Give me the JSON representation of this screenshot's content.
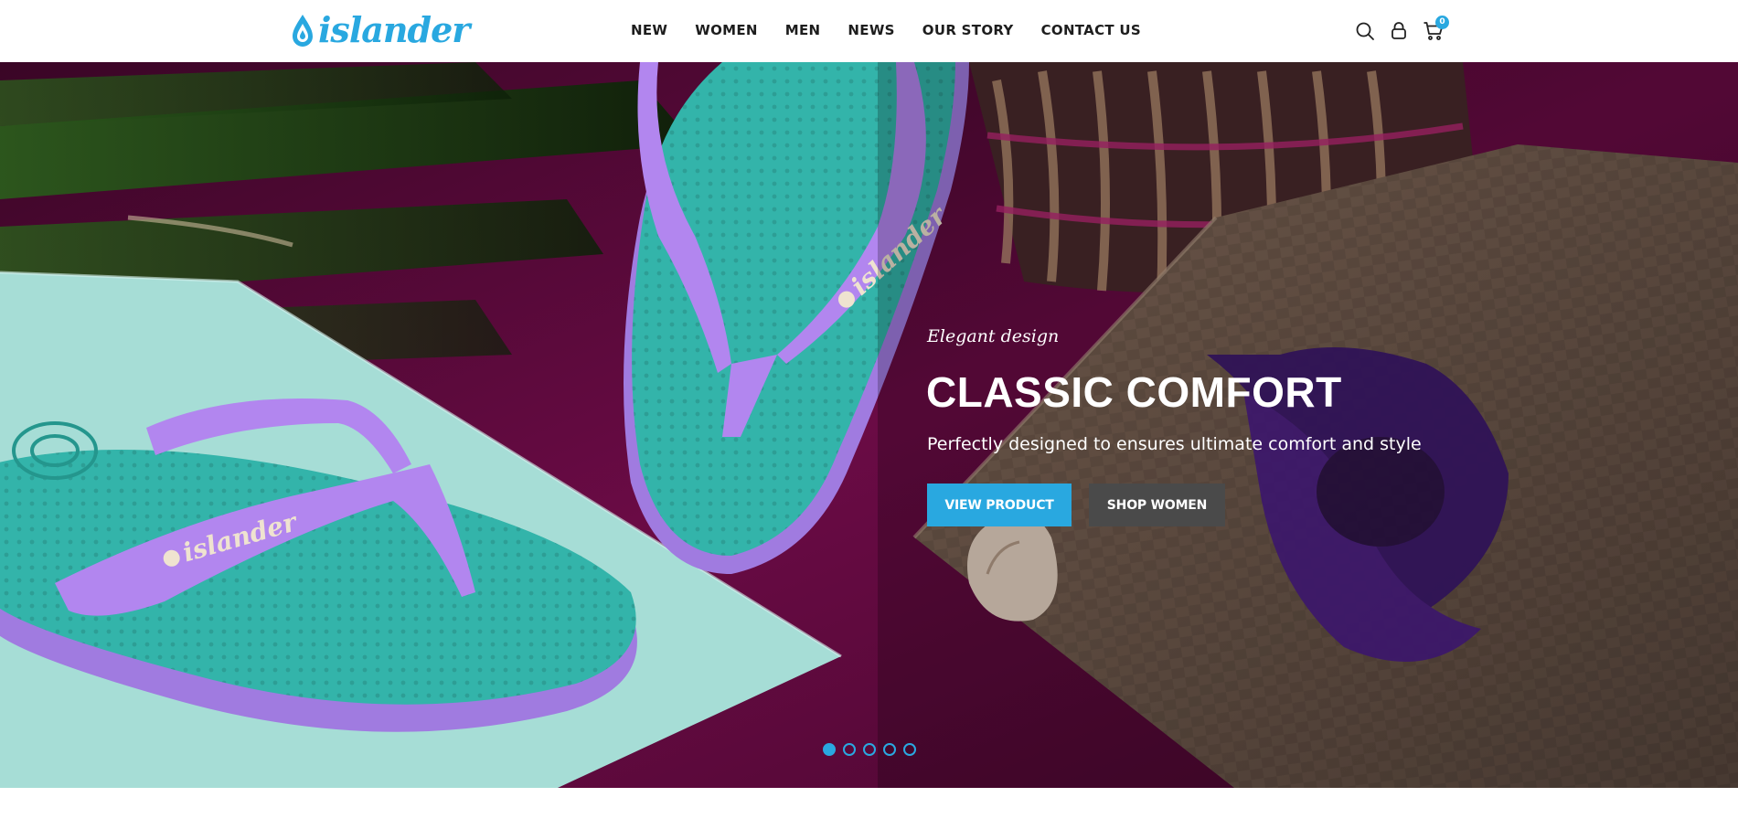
{
  "brand": {
    "logo_text": "islander",
    "accent_color": "#29a8e0"
  },
  "nav": {
    "items": [
      {
        "label": "NEW"
      },
      {
        "label": "WOMEN"
      },
      {
        "label": "MEN"
      },
      {
        "label": "NEWS"
      },
      {
        "label": "OUR STORY"
      },
      {
        "label": "CONTACT US"
      }
    ]
  },
  "header_icons": {
    "search": "search-icon",
    "account": "user-icon",
    "cart": "cart-icon",
    "cart_count": "0"
  },
  "hero": {
    "subtitle": "Elegant design",
    "title": "CLASSIC COMFORT",
    "description": "Perfectly designed to ensures ultimate comfort and style",
    "primary_button": "VIEW PRODUCT",
    "secondary_button": "SHOP WOMEN",
    "primary_color": "#29a8e0",
    "secondary_color": "#4a4a4a",
    "slides_total": 5,
    "active_slide": 1
  }
}
